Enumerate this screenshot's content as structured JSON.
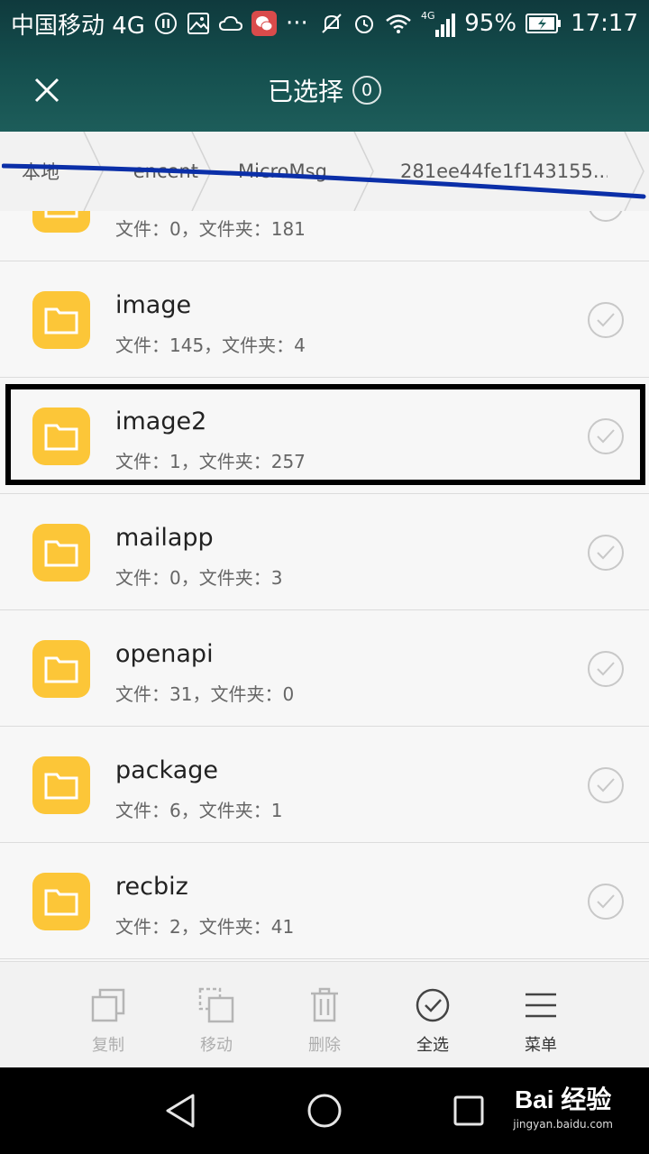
{
  "status_bar": {
    "carrier": "中国移动 4G",
    "more": "···",
    "network": "4G",
    "battery": "95%",
    "time": "17:17"
  },
  "header": {
    "title": "已选择",
    "selected_count": "0"
  },
  "breadcrumb": [
    "本地",
    "encent",
    "MicroMsg",
    "281ee44fe1f143155..."
  ],
  "files": [
    {
      "name": "",
      "meta": "文件：0，文件夹：181"
    },
    {
      "name": "image",
      "meta": "文件：145，文件夹：4"
    },
    {
      "name": "image2",
      "meta": "文件：1，文件夹：257"
    },
    {
      "name": "mailapp",
      "meta": "文件：0，文件夹：3"
    },
    {
      "name": "openapi",
      "meta": "文件：31，文件夹：0"
    },
    {
      "name": "package",
      "meta": "文件：6，文件夹：1"
    },
    {
      "name": "recbiz",
      "meta": "文件：2，文件夹：41"
    }
  ],
  "toolbar": {
    "copy": "复制",
    "move": "移动",
    "delete": "删除",
    "select_all": "全选",
    "menu": "菜单"
  },
  "watermark": {
    "logo": "Bai 经验",
    "url": "jingyan.baidu.com"
  },
  "colors": {
    "header_bg": "#15504f",
    "folder": "#fcc638",
    "underline": "#0b2fa8"
  }
}
